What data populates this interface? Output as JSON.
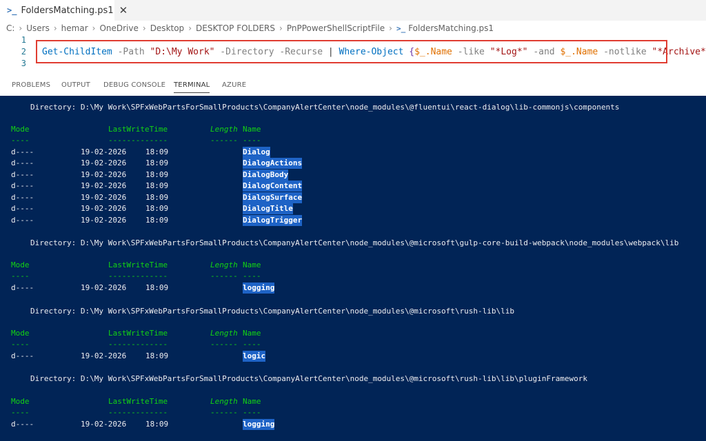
{
  "tab": {
    "title": "FoldersMatching.ps1",
    "icon": "powershell-icon"
  },
  "breadcrumb": [
    "C:",
    "Users",
    "hemar",
    "OneDrive",
    "Desktop",
    "DESKTOP FOLDERS",
    "PnPPowerShellScriptFile",
    "FoldersMatching.ps1"
  ],
  "editor": {
    "line_numbers": [
      "1",
      "2",
      "3"
    ],
    "code": {
      "cmd1": "Get-ChildItem",
      "param_path": "-Path",
      "path_value": "\"D:\\My Work\"",
      "param_dir": "-Directory",
      "param_recurse": "-Recurse",
      "pipe": "|",
      "cmd2": "Where-Object",
      "brace_open": "{",
      "var1": "$_.Name",
      "op_like": "-like",
      "str_log": "\"*Log*\"",
      "op_and": "-and",
      "var2": "$_.Name",
      "op_notlike": "-notlike",
      "str_archive": "\"*Archive*\"",
      "brace_close": "}"
    },
    "highlight_color": "#e03c31"
  },
  "panel_tabs": [
    "PROBLEMS",
    "OUTPUT",
    "DEBUG CONSOLE",
    "TERMINAL",
    "AZURE"
  ],
  "active_panel_tab": "TERMINAL",
  "terminal": {
    "headers": {
      "mode": "Mode",
      "lastwritetime": "LastWriteTime",
      "length": "Length",
      "name": "Name"
    },
    "underlines": {
      "mode": "----",
      "lastwritetime": "-------------",
      "length": "------",
      "name": "----"
    },
    "groups": [
      {
        "directory": "Directory: D:\\My Work\\SPFxWebPartsForSmallProducts\\CompanyAlertCenter\\node_modules\\@fluentui\\react-dialog\\lib-commonjs\\components",
        "rows": [
          {
            "mode": "d----",
            "date": "19-02-2026",
            "time": "18:09",
            "name": "Dialog"
          },
          {
            "mode": "d----",
            "date": "19-02-2026",
            "time": "18:09",
            "name": "DialogActions"
          },
          {
            "mode": "d----",
            "date": "19-02-2026",
            "time": "18:09",
            "name": "DialogBody"
          },
          {
            "mode": "d----",
            "date": "19-02-2026",
            "time": "18:09",
            "name": "DialogContent"
          },
          {
            "mode": "d----",
            "date": "19-02-2026",
            "time": "18:09",
            "name": "DialogSurface"
          },
          {
            "mode": "d----",
            "date": "19-02-2026",
            "time": "18:09",
            "name": "DialogTitle"
          },
          {
            "mode": "d----",
            "date": "19-02-2026",
            "time": "18:09",
            "name": "DialogTrigger"
          }
        ]
      },
      {
        "directory": "Directory: D:\\My Work\\SPFxWebPartsForSmallProducts\\CompanyAlertCenter\\node_modules\\@microsoft\\gulp-core-build-webpack\\node_modules\\webpack\\lib",
        "rows": [
          {
            "mode": "d----",
            "date": "19-02-2026",
            "time": "18:09",
            "name": "logging"
          }
        ]
      },
      {
        "directory": "Directory: D:\\My Work\\SPFxWebPartsForSmallProducts\\CompanyAlertCenter\\node_modules\\@microsoft\\rush-lib\\lib",
        "rows": [
          {
            "mode": "d----",
            "date": "19-02-2026",
            "time": "18:09",
            "name": "logic"
          }
        ]
      },
      {
        "directory": "Directory: D:\\My Work\\SPFxWebPartsForSmallProducts\\CompanyAlertCenter\\node_modules\\@microsoft\\rush-lib\\lib\\pluginFramework",
        "rows": [
          {
            "mode": "d----",
            "date": "19-02-2026",
            "time": "18:09",
            "name": "logging"
          }
        ]
      }
    ],
    "colors": {
      "background": "#012456",
      "header": "#13d313",
      "text": "#eeedf0",
      "selection": "#1e63c6"
    }
  }
}
